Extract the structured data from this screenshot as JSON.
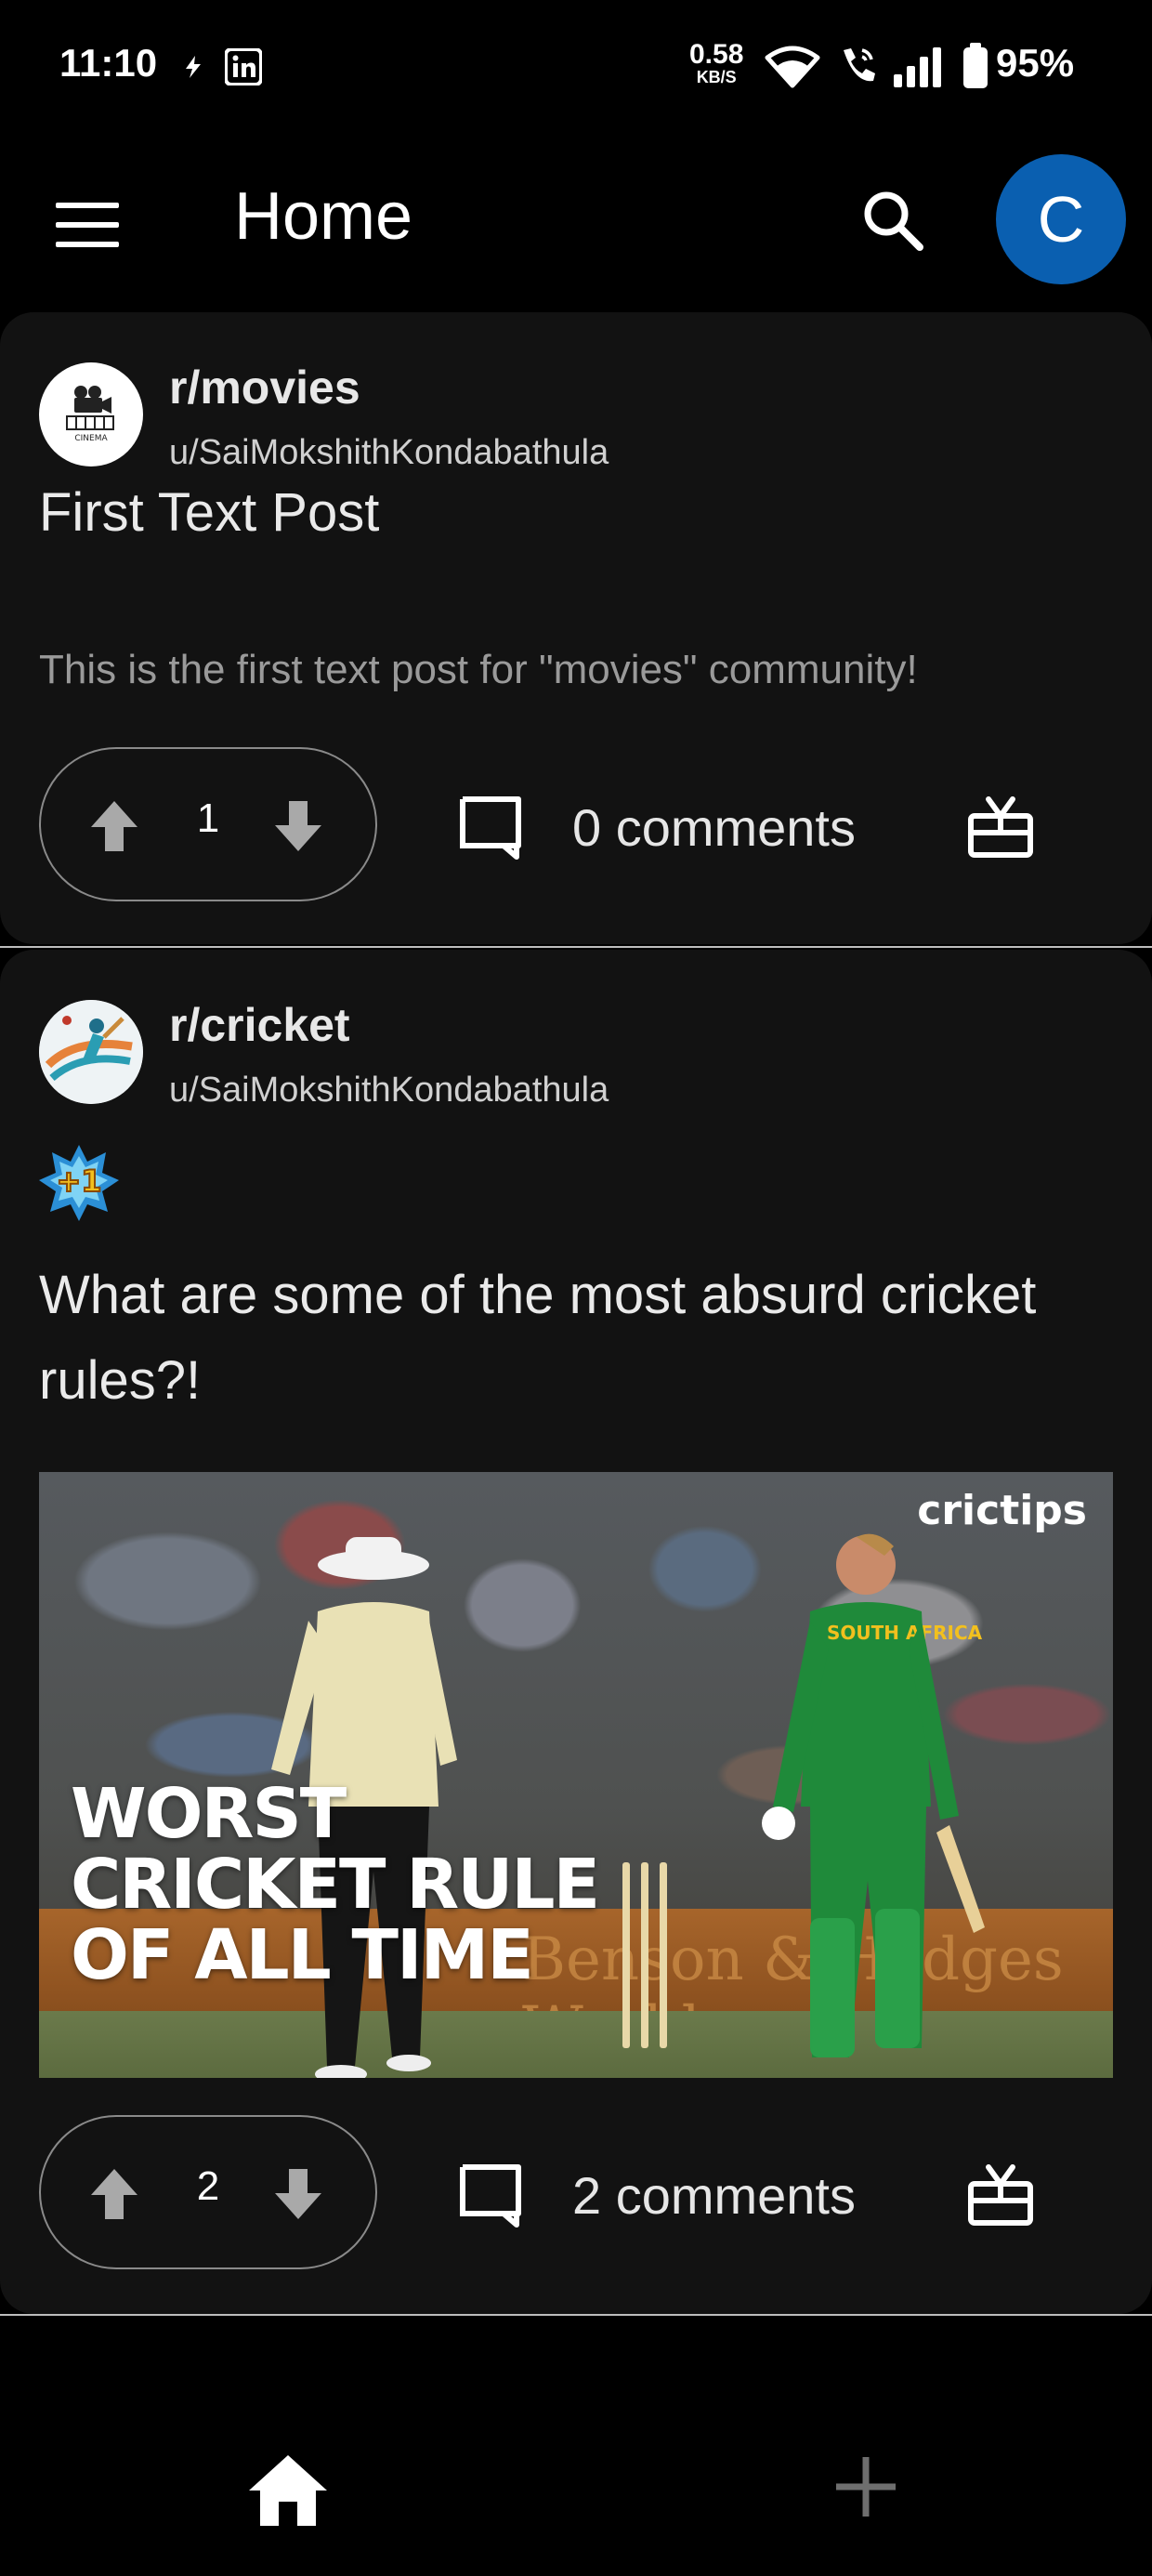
{
  "status_bar": {
    "time": "11:10",
    "speed_value": "0.58",
    "speed_unit": "KB/S",
    "battery": "95%"
  },
  "app_bar": {
    "title": "Home",
    "avatar_letter": "C",
    "avatar_color": "#0a5fb0"
  },
  "posts": [
    {
      "community": "r/movies",
      "author": "u/SaiMokshithKondabathula",
      "title": "First Text Post",
      "body": "This is the first text post for \"movies\" community!",
      "votes": "1",
      "comments": "0 comments"
    },
    {
      "community": "r/cricket",
      "author": "u/SaiMokshithKondabathula",
      "title": "What are some of the most absurd cricket rules?!",
      "image_overlay": [
        "WORST",
        "CRICKET RULE",
        "OF ALL TIME"
      ],
      "image_brand": "crictips",
      "votes": "2",
      "comments": "2 comments"
    }
  ],
  "movies_logo_text": "CINEMA",
  "badge_text": "+1",
  "jersey_text": "SOUTH AFRICA",
  "hoarding_text": "Benson & Hedges World",
  "icons": {
    "menu": "menu-icon",
    "search": "search-icon",
    "upvote": "arrow-up-icon",
    "downvote": "arrow-down-icon",
    "comment": "comment-icon",
    "award": "gift-icon",
    "home": "home-icon",
    "add": "plus-icon"
  }
}
